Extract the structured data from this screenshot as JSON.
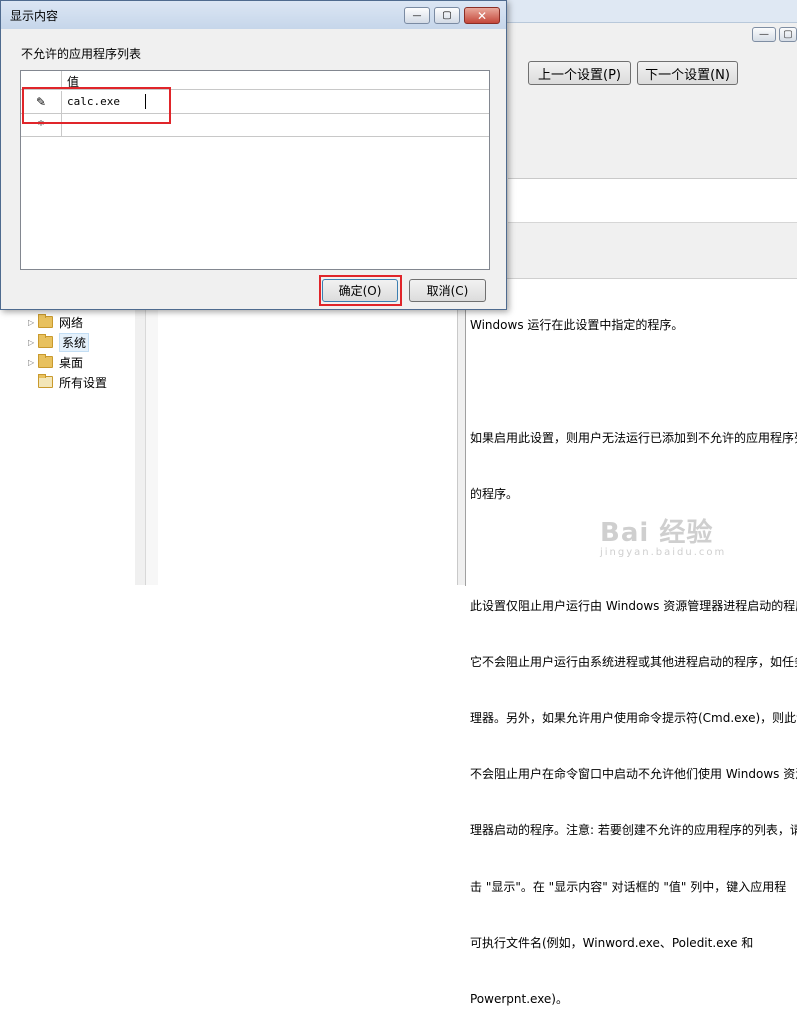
{
  "dialog": {
    "title": "显示内容",
    "list_label": "不允许的应用程序列表",
    "column_header": "值",
    "rows": [
      {
        "marker": "✎",
        "value": "calc.exe"
      },
      {
        "marker": "*",
        "value": ""
      }
    ],
    "ok_label": "确定(O)",
    "cancel_label": "取消(C)",
    "caption": {
      "minimize": "—",
      "maximize": "▢",
      "close": "✕"
    },
    "highlight_color": "#e0252a"
  },
  "background": {
    "caption": {
      "minimize": "—",
      "maximize": "▢"
    },
    "prev_setting_label": "上一个设置(P)",
    "next_setting_label": "下一个设置(N)",
    "tree": [
      {
        "label": "网络",
        "icon": "folder-icon"
      },
      {
        "label": "系统",
        "icon": "folder-icon",
        "selected": true
      },
      {
        "label": "桌面",
        "icon": "folder-icon"
      },
      {
        "label": "所有设置",
        "icon": "settings-folder-icon"
      }
    ],
    "help_lines": [
      "Windows 运行在此设置中指定的程序。",
      "",
      "如果启用此设置，则用户无法运行已添加到不允许的应用程序列",
      "的程序。",
      "",
      "此设置仅阻止用户运行由 Windows 资源管理器进程启动的程序",
      "它不会阻止用户运行由系统进程或其他进程启动的程序，如任务",
      "理器。另外，如果允许用户使用命令提示符(Cmd.exe)，则此设",
      "不会阻止用户在命令窗口中启动不允许他们使用 Windows 资源",
      "理器启动的程序。注意: 若要创建不允许的应用程序的列表，请",
      "击 \"显示\"。在 \"显示内容\" 对话框的 \"值\" 列中，键入应用程",
      "可执行文件名(例如，Winword.exe、Poledit.exe 和",
      "Powerpnt.exe)。"
    ]
  },
  "watermark": {
    "logo": "Bai 经验",
    "url": "jingyan.baidu.com"
  }
}
